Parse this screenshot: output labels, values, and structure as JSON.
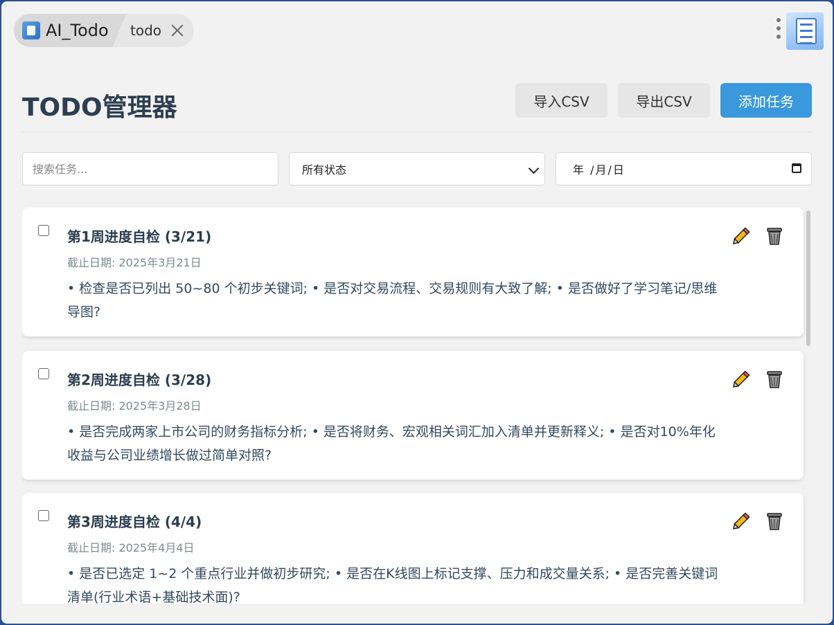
{
  "titlebar": {
    "app_name": "AI_Todo",
    "page_tab": "todo"
  },
  "header": {
    "title": "TODO管理器",
    "import_label": "导入CSV",
    "export_label": "导出CSV",
    "add_label": "添加任务"
  },
  "filters": {
    "search_placeholder": "搜索任务...",
    "status_value": "所有状态",
    "date_placeholder": "年 /月/日"
  },
  "tasks": [
    {
      "title": "第1周进度自检 (3/21)",
      "due": "截止日期: 2025年3月21日",
      "desc": "• 检查是否已列出 50~80 个初步关键词; • 是否对交易流程、交易规则有大致了解; • 是否做好了学习笔记/思维导图?",
      "done": false
    },
    {
      "title": "第2周进度自检 (3/28)",
      "due": "截止日期: 2025年3月28日",
      "desc": "• 是否完成两家上市公司的财务指标分析; • 是否将财务、宏观相关词汇加入清单并更新释义; • 是否对10%年化收益与公司业绩增长做过简单对照?",
      "done": false
    },
    {
      "title": "第3周进度自检 (4/4)",
      "due": "截止日期: 2025年4月4日",
      "desc": "• 是否已选定 1~2 个重点行业并做初步研究; • 是否在K线图上标记支撑、压力和成交量关系; • 是否完善关键词清单(行业术语+基础技术面)?",
      "done": false
    }
  ]
}
